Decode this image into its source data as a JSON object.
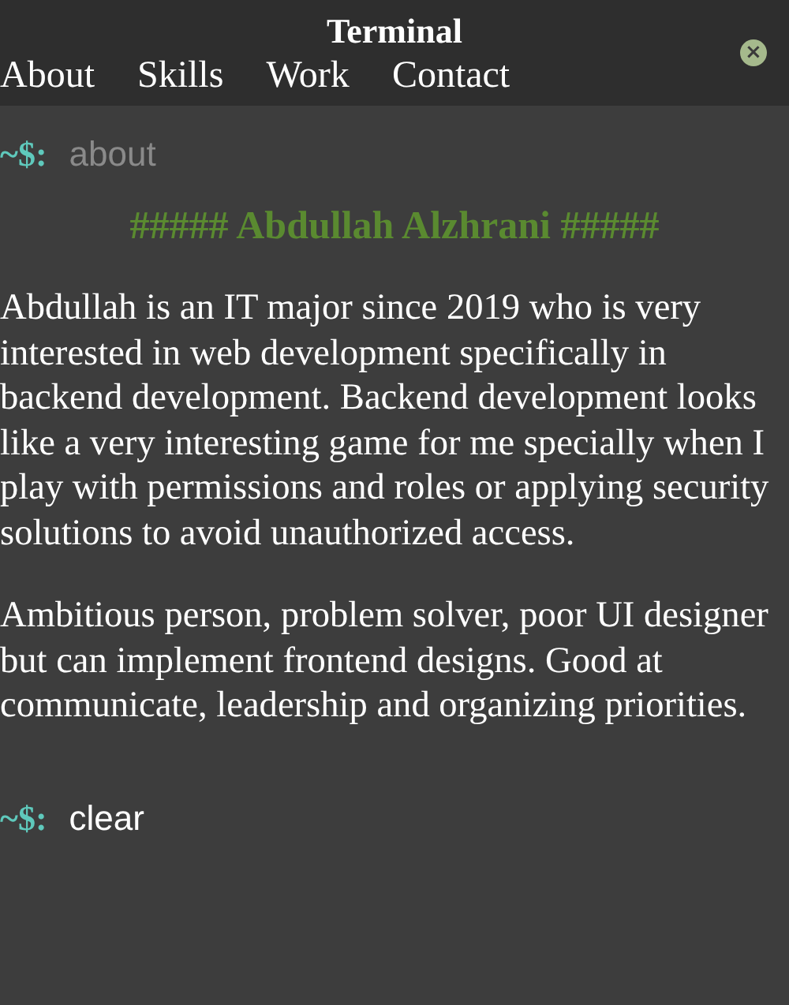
{
  "window": {
    "title": "Terminal"
  },
  "nav": [
    {
      "label": "About"
    },
    {
      "label": "Skills"
    },
    {
      "label": "Work"
    },
    {
      "label": "Contact"
    }
  ],
  "close_button": {
    "label": "×"
  },
  "entries": [
    {
      "kind": "command",
      "prompt": "~$:",
      "command": "about"
    },
    {
      "kind": "heading",
      "text": "##### Abdullah Alzhrani #####"
    },
    {
      "kind": "paragraph",
      "text": "Abdullah is an IT major since 2019 who is very interested in web development specifically in backend development. Backend development looks like a very interesting game for me specially when I play with permissions and roles or applying security solutions to avoid unauthorized access."
    },
    {
      "kind": "paragraph",
      "text": "Ambitious person, problem solver, poor UI designer but can implement frontend designs. Good at communicate, leadership and organizing priorities."
    },
    {
      "kind": "input",
      "prompt": "~$:",
      "value": "clear"
    }
  ]
}
